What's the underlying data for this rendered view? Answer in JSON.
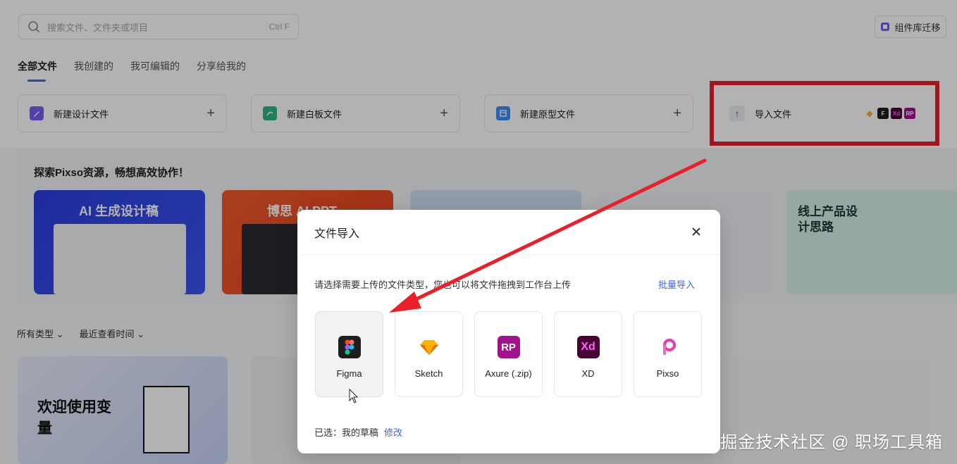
{
  "header": {
    "search_placeholder": "搜索文件、文件夹或项目",
    "search_shortcut": "Ctrl F",
    "library_migrate_label": "组件库迁移"
  },
  "tabs": [
    {
      "label": "全部文件",
      "active": true
    },
    {
      "label": "我创建的",
      "active": false
    },
    {
      "label": "我可编辑的",
      "active": false
    },
    {
      "label": "分享给我的",
      "active": false
    }
  ],
  "create_cards": [
    {
      "label": "新建设计文件",
      "icon": "design-file-icon",
      "color": "#7b5cf0"
    },
    {
      "label": "新建白板文件",
      "icon": "whiteboard-file-icon",
      "color": "#2fb67c"
    },
    {
      "label": "新建原型文件",
      "icon": "prototype-file-icon",
      "color": "#3a8df5"
    }
  ],
  "import_card": {
    "label": "导入文件",
    "icon": "upload-icon"
  },
  "explore": {
    "title": "探索Pixso资源，畅想高效协作！",
    "banners": [
      {
        "title": "AI 生成设计稿"
      },
      {
        "title": "博思 AI PPT"
      },
      {
        "title": ""
      },
      {
        "title": ""
      },
      {
        "title": "线上产品设计思路"
      }
    ]
  },
  "filters": {
    "type_label": "所有类型",
    "sort_label": "最近查看时间"
  },
  "file_cards": [
    {
      "title": "欢迎使用变量"
    }
  ],
  "modal": {
    "title": "文件导入",
    "description": "请选择需要上传的文件类型，您也可以将文件拖拽到工作台上传",
    "batch_import_label": "批量导入",
    "types": [
      {
        "label": "Figma",
        "icon": "figma-icon",
        "selected": true
      },
      {
        "label": "Sketch",
        "icon": "sketch-icon",
        "selected": false
      },
      {
        "label": "Axure (.zip)",
        "icon": "axure-rp-icon",
        "selected": false
      },
      {
        "label": "XD",
        "icon": "adobe-xd-icon",
        "selected": false
      },
      {
        "label": "Pixso",
        "icon": "pixso-icon",
        "selected": false
      }
    ],
    "selected_prefix": "已选：",
    "selected_location": "我的草稿",
    "edit_label": "修改"
  },
  "colors": {
    "accent": "#3a63f3",
    "highlight_red": "#e8202a",
    "mini_figma": "#1e1e1e",
    "mini_xd": "#470137",
    "mini_rp": "#a4118f"
  },
  "mini_icons": [
    "sketch-mini-icon",
    "figma-mini-icon",
    "xd-mini-icon",
    "rp-mini-icon"
  ],
  "watermark": "掘金技术社区 @ 职场工具箱"
}
